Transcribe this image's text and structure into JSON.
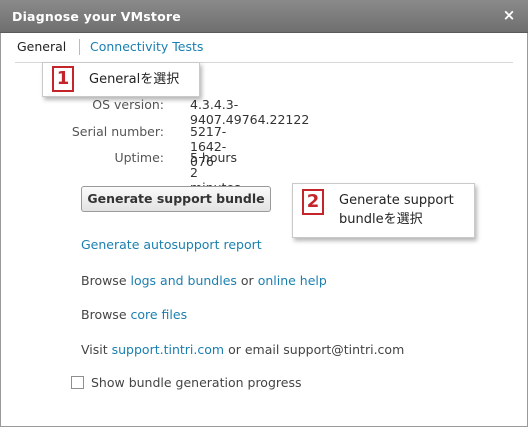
{
  "window": {
    "title": "Diagnose your VMstore",
    "close_glyph": "×"
  },
  "tabs": [
    {
      "label": "General"
    },
    {
      "label": "Connectivity Tests"
    }
  ],
  "info": {
    "os_version_label": "OS version:",
    "os_version_value": "4.3.4.3-9407.49764.22122",
    "serial_label": "Serial number:",
    "serial_value": "5217-1642-076",
    "uptime_label": "Uptime:",
    "uptime_value": "5 hours 2 minutes"
  },
  "actions": {
    "generate_bundle_label": "Generate support bundle",
    "autosupport_link": "Generate autosupport report",
    "browse1_prefix": "Browse",
    "logs_link": "logs and bundles",
    "browse1_or": "or",
    "help_link": "online help",
    "browse2_prefix": "Browse",
    "core_link": "core files",
    "visit_prefix": "Visit",
    "support_link": "support.tintri.com",
    "email_text": "or email support@tintri.com",
    "progress_checkbox_label": "Show bundle generation progress",
    "progress_checked": false
  },
  "callouts": [
    {
      "number": "1",
      "text": "Generalを選択"
    },
    {
      "number": "2",
      "line1": "Generate support",
      "line2": "bundleを選択"
    }
  ],
  "colors": {
    "titlebar": "#7d7d7d",
    "link": "#1a7fb0",
    "callout_accent": "#c4252a"
  }
}
